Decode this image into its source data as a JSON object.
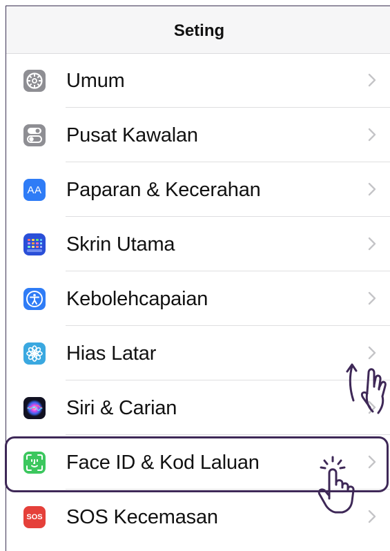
{
  "header": {
    "title": "Seting"
  },
  "settings": {
    "items": [
      {
        "label": "Umum",
        "icon": "gear-icon",
        "color": "#8e8e93"
      },
      {
        "label": "Pusat Kawalan",
        "icon": "toggles-icon",
        "color": "#8e8e93"
      },
      {
        "label": "Paparan & Kecerahan",
        "icon": "text-size-icon",
        "color": "#2f7cf6"
      },
      {
        "label": "Skrin Utama",
        "icon": "home-grid-icon",
        "color": "#2a4fd8"
      },
      {
        "label": "Kebolehcapaian",
        "icon": "accessibility-icon",
        "color": "#2f7cf6"
      },
      {
        "label": "Hias Latar",
        "icon": "flower-icon",
        "color": "#3aa8e0"
      },
      {
        "label": "Siri & Carian",
        "icon": "siri-icon",
        "color": "#1b1b2e"
      },
      {
        "label": "Face ID & Kod Laluan",
        "icon": "face-id-icon",
        "color": "#3cc75e"
      },
      {
        "label": "SOS Kecemasan",
        "icon": "sos-icon",
        "color": "#e5403a"
      }
    ]
  },
  "icons": {
    "aa_text": "AA",
    "sos_text": "SOS"
  },
  "annotation": {
    "highlight_color": "#3e2857",
    "highlighted_item": "Face ID & Kod Laluan",
    "gestures": [
      "swipe-up-hand-icon",
      "tap-hand-icon"
    ]
  }
}
